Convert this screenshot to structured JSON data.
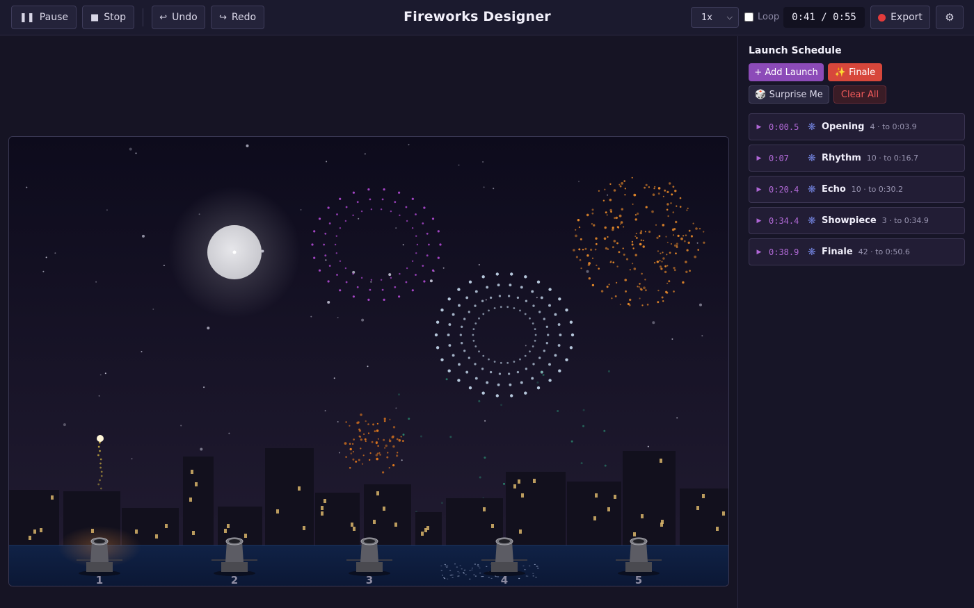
{
  "toolbar": {
    "pause_label": "Pause",
    "stop_label": "Stop",
    "undo_label": "Undo",
    "redo_label": "Redo",
    "title": "Fireworks Designer",
    "speed_value": "1x",
    "loop_label": "Loop",
    "loop_checked": false,
    "time_display": "0:41 / 0:55",
    "export_label": "Export",
    "icons": {
      "pause": "pause-icon",
      "stop": "stop-icon",
      "undo": "undo-icon",
      "redo": "redo-icon",
      "export": "record-dot-icon",
      "settings": "gear-icon"
    }
  },
  "stage": {
    "launchers": [
      {
        "label": "1"
      },
      {
        "label": "2"
      },
      {
        "label": "3"
      },
      {
        "label": "4"
      },
      {
        "label": "5"
      }
    ],
    "colors": {
      "sky_top": "#0d0b1c",
      "sky_bottom": "#201b30",
      "water": "#0d1c3c",
      "moon": "#d8d8dc"
    },
    "bursts": [
      {
        "color": "#b24ad6",
        "shape": "ring"
      },
      {
        "color": "#e88a2a",
        "shape": "peony"
      },
      {
        "color": "#c8dcf0",
        "shape": "ring"
      },
      {
        "color": "#e0781e",
        "shape": "peony"
      }
    ]
  },
  "sidebar": {
    "title": "Launch Schedule",
    "add_label": "+ Add Launch",
    "finale_label": "✨ Finale",
    "surprise_label": "🎲 Surprise Me",
    "clear_label": "Clear All",
    "launches": [
      {
        "time": "0:00.5",
        "name": "Opening",
        "meta": "4 · to 0:03.9"
      },
      {
        "time": "0:07",
        "name": "Rhythm",
        "meta": "10 · to 0:16.7"
      },
      {
        "time": "0:20.4",
        "name": "Echo",
        "meta": "10 · to 0:30.2"
      },
      {
        "time": "0:34.4",
        "name": "Showpiece",
        "meta": "3 · to 0:34.9"
      },
      {
        "time": "0:38.9",
        "name": "Finale",
        "meta": "42 · to 0:50.6"
      }
    ]
  }
}
